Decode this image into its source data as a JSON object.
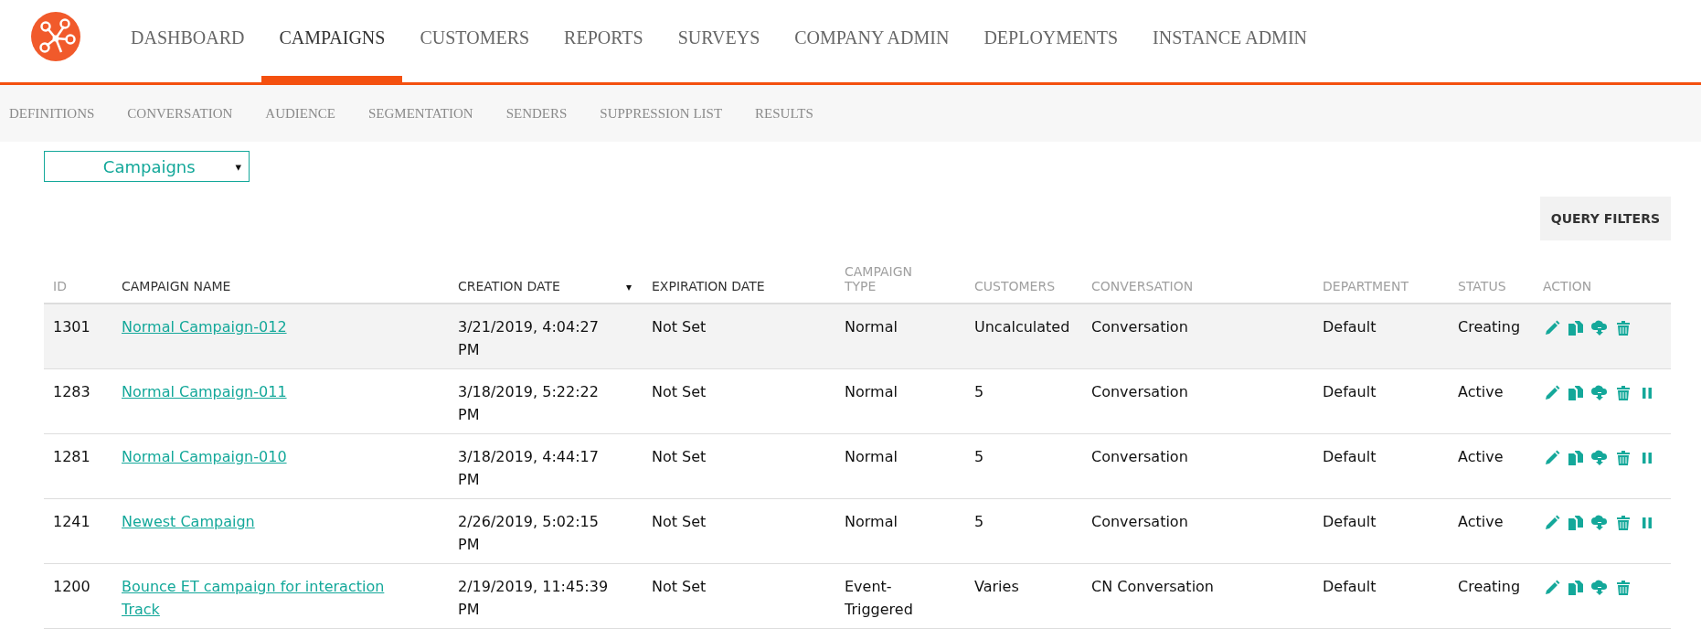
{
  "top_nav": [
    {
      "label": "DASHBOARD",
      "selected": false
    },
    {
      "label": "CAMPAIGNS",
      "selected": true
    },
    {
      "label": "CUSTOMERS",
      "selected": false
    },
    {
      "label": "REPORTS",
      "selected": false
    },
    {
      "label": "SURVEYS",
      "selected": false
    },
    {
      "label": "COMPANY ADMIN",
      "selected": false
    },
    {
      "label": "DEPLOYMENTS",
      "selected": false
    },
    {
      "label": "INSTANCE ADMIN",
      "selected": false
    }
  ],
  "sub_nav": [
    "DEFINITIONS",
    "CONVERSATION",
    "AUDIENCE",
    "SEGMENTATION",
    "SENDERS",
    "SUPPRESSION LIST",
    "RESULTS"
  ],
  "view_select": {
    "value": "Campaigns",
    "caret": "▾"
  },
  "query_filters_button": "QUERY FILTERS",
  "table": {
    "columns": [
      {
        "label": "ID",
        "sortable": false
      },
      {
        "label": "CAMPAIGN NAME",
        "sortable": true
      },
      {
        "label": "CREATION DATE",
        "sortable": true,
        "sort_indicator": "▾"
      },
      {
        "label": "EXPIRATION DATE",
        "sortable": true
      },
      {
        "label": "CAMPAIGN TYPE",
        "sortable": false
      },
      {
        "label": "CUSTOMERS",
        "sortable": false
      },
      {
        "label": "CONVERSATION",
        "sortable": false
      },
      {
        "label": "DEPARTMENT",
        "sortable": false
      },
      {
        "label": "STATUS",
        "sortable": false
      },
      {
        "label": "ACTION",
        "sortable": false
      }
    ],
    "rows": [
      {
        "id": "1301",
        "name": "Normal Campaign-012",
        "creation_date": "3/21/2019, 4:04:27 PM",
        "expiration_date": "Not Set",
        "type": "Normal",
        "customers": "Uncalculated",
        "conversation": "Conversation",
        "department": "Default",
        "status": "Creating",
        "highlighted": true,
        "pausable": false
      },
      {
        "id": "1283",
        "name": "Normal Campaign-011",
        "creation_date": "3/18/2019, 5:22:22 PM",
        "expiration_date": "Not Set",
        "type": "Normal",
        "customers": "5",
        "conversation": "Conversation",
        "department": "Default",
        "status": "Active",
        "highlighted": false,
        "pausable": true
      },
      {
        "id": "1281",
        "name": "Normal Campaign-010",
        "creation_date": "3/18/2019, 4:44:17 PM",
        "expiration_date": "Not Set",
        "type": "Normal",
        "customers": "5",
        "conversation": "Conversation",
        "department": "Default",
        "status": "Active",
        "highlighted": false,
        "pausable": true
      },
      {
        "id": "1241",
        "name": "Newest Campaign",
        "creation_date": "2/26/2019, 5:02:15 PM",
        "expiration_date": "Not Set",
        "type": "Normal",
        "customers": "5",
        "conversation": "Conversation",
        "department": "Default",
        "status": "Active",
        "highlighted": false,
        "pausable": true
      },
      {
        "id": "1200",
        "name": "Bounce ET campaign for interaction Track",
        "creation_date": "2/19/2019, 11:45:39 PM",
        "expiration_date": "Not Set",
        "type": "Event-Triggered",
        "customers": "Varies",
        "conversation": "CN Conversation",
        "department": "Default",
        "status": "Creating",
        "highlighted": false,
        "pausable": false
      }
    ]
  }
}
